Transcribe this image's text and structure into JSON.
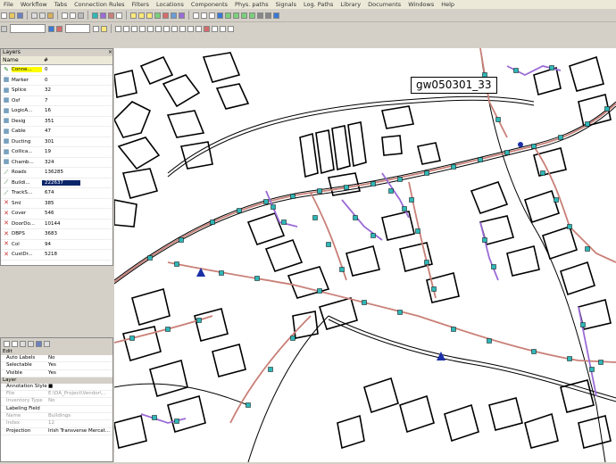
{
  "menu": [
    "File",
    "Workflow",
    "Tabs",
    "Connection Rules",
    "Filters",
    "Locations",
    "Components",
    "Phys. paths",
    "Signals",
    "Log. Paths",
    "Library",
    "Documents",
    "Windows",
    "Help"
  ],
  "layers_panel": {
    "title": "Layers",
    "col_name": "Name",
    "col_count": "#",
    "rows": [
      {
        "name": "Conne...",
        "count": "0",
        "icon": "pencil",
        "highlight": true
      },
      {
        "name": "Marker",
        "count": "0",
        "icon": "layer"
      },
      {
        "name": "Splice",
        "count": "32",
        "icon": "layer"
      },
      {
        "name": "Osf",
        "count": "7",
        "icon": "layer"
      },
      {
        "name": "LogicA...",
        "count": "16",
        "icon": "layer"
      },
      {
        "name": "Desig",
        "count": "351",
        "icon": "layer"
      },
      {
        "name": "Cable",
        "count": "47",
        "icon": "layer"
      },
      {
        "name": "Ducting",
        "count": "301",
        "icon": "layer"
      },
      {
        "name": "Collica...",
        "count": "19",
        "icon": "layer"
      },
      {
        "name": "Chamb...",
        "count": "324",
        "icon": "layer"
      },
      {
        "name": "Roads",
        "count": "136285",
        "icon": "line"
      },
      {
        "name": "Buildi...",
        "count": "222637",
        "icon": "line",
        "selected": true
      },
      {
        "name": "TrackS...",
        "count": "674",
        "icon": "line"
      },
      {
        "name": "Sml",
        "count": "385",
        "icon": "x"
      },
      {
        "name": "Cover",
        "count": "546",
        "icon": "x"
      },
      {
        "name": "DoorDo...",
        "count": "10144",
        "icon": "x"
      },
      {
        "name": "DBPS",
        "count": "3683",
        "icon": "x"
      },
      {
        "name": "Col",
        "count": "94",
        "icon": "x"
      },
      {
        "name": "CustDr...",
        "count": "5218",
        "icon": "x"
      }
    ]
  },
  "properties_panel": {
    "cat_edit": "Edit",
    "rows_edit": [
      {
        "k": "Auto Labels",
        "v": "No"
      },
      {
        "k": "Selectable",
        "v": "Yes"
      },
      {
        "k": "Visible",
        "v": "Yes"
      }
    ],
    "cat_layer": "Layer",
    "rows_layer": [
      {
        "k": "Annotation Style",
        "v": "■",
        "grey": false
      },
      {
        "k": "File",
        "v": "E:\\DA_Project\\Vendor\\...",
        "grey": true
      },
      {
        "k": "Inventory Type",
        "v": "No",
        "grey": true
      },
      {
        "k": "Labeling Field",
        "v": "",
        "grey": false
      },
      {
        "k": "Name",
        "v": "Buildings",
        "grey": true
      },
      {
        "k": "Index",
        "v": "12",
        "grey": true
      },
      {
        "k": "Projection",
        "v": "Irish Transverse Mercat...",
        "grey": false
      }
    ]
  },
  "map": {
    "callout_label": "gw050301_33"
  },
  "colors": {
    "road_red": "#c98078",
    "duct_purple": "#9b6bd6",
    "node_teal": "#2fb7b7",
    "chamber_blue": "#1a2fa8",
    "selection": "#0a246a",
    "highlight": "#ffff00"
  }
}
